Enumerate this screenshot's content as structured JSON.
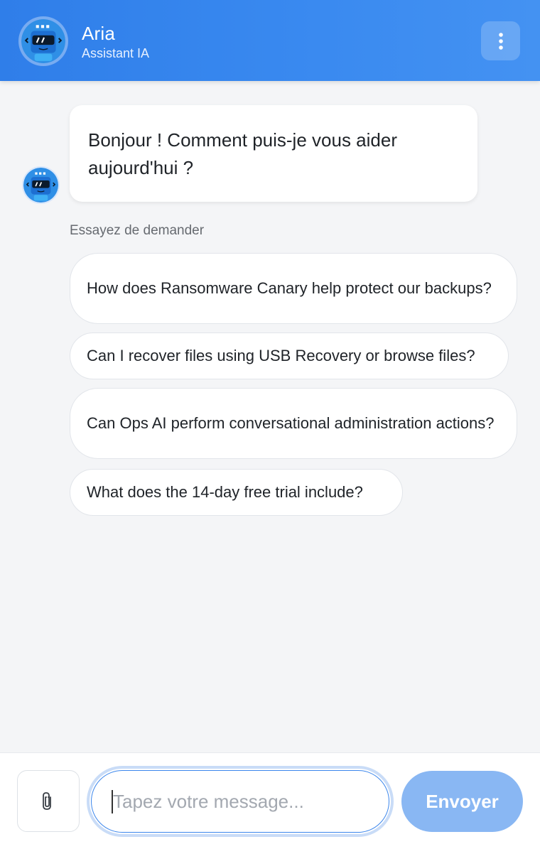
{
  "header": {
    "name": "Aria",
    "subtitle": "Assistant IA",
    "menu_icon": "more-vertical-icon"
  },
  "messages": [
    {
      "sender": "bot",
      "text": "Bonjour ! Comment puis-je vous aider aujourd'hui ?"
    }
  ],
  "suggestions": {
    "label": "Essayez de demander",
    "items": [
      "How does Ransomware Canary help protect our backups?",
      "Can I recover files using USB Recovery or browse files?",
      "Can Ops AI perform conversational administration actions?",
      "What does the 14-day free trial include?"
    ]
  },
  "composer": {
    "attach_icon": "paperclip-icon",
    "placeholder": "Tapez votre message...",
    "value": "",
    "send_label": "Envoyer"
  },
  "colors": {
    "header": "#3a8af0",
    "send_disabled": "#89b7f3",
    "background": "#f4f5f7"
  }
}
